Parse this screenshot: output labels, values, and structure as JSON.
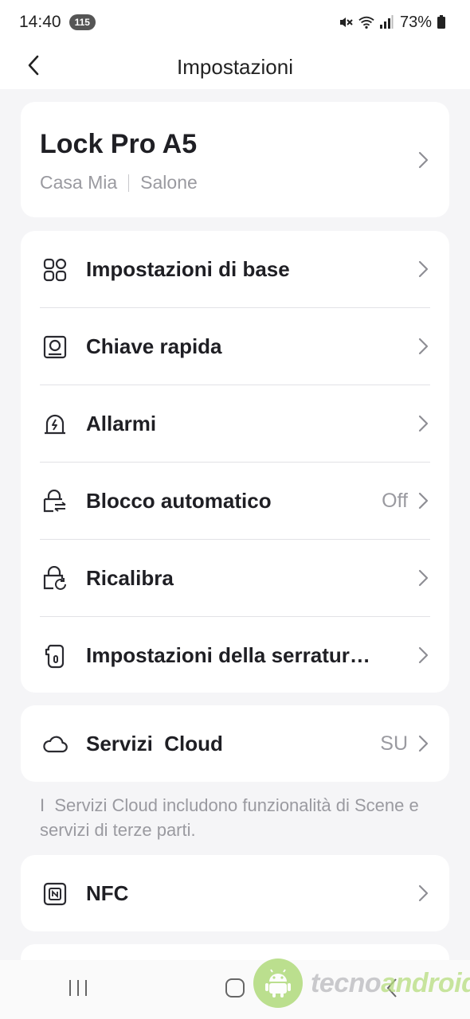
{
  "status_bar": {
    "time": "14:40",
    "notification_count": "115",
    "battery": "73%"
  },
  "header": {
    "title": "Impostazioni"
  },
  "device": {
    "name": "Lock Pro A5",
    "home": "Casa Mia",
    "room": "Salone"
  },
  "menu": {
    "items": [
      {
        "label": "Impostazioni di base",
        "icon": "grid-icon",
        "value": ""
      },
      {
        "label": "Chiave rapida",
        "icon": "quick-key-icon",
        "value": ""
      },
      {
        "label": "Allarmi",
        "icon": "alarm-icon",
        "value": ""
      },
      {
        "label": "Blocco automatico",
        "icon": "auto-lock-icon",
        "value": "Off"
      },
      {
        "label": "Ricalibra",
        "icon": "recalibrate-icon",
        "value": ""
      },
      {
        "label": "Impostazioni della serratur…",
        "icon": "lock-settings-icon",
        "value": ""
      }
    ]
  },
  "cloud": {
    "label": "Servizi  Cloud",
    "value": "SU",
    "note": "I  Servizi Cloud includono funzionalità di Scene e servizi di terze parti."
  },
  "nfc": {
    "label": "NFC"
  },
  "watermark": {
    "part1": "tecno",
    "part2": "android"
  },
  "colors": {
    "background": "#f5f5f7",
    "card": "#ffffff",
    "text": "#1f1f24",
    "muted": "#9a9aa0",
    "watermark_green": "#a6d66a"
  }
}
